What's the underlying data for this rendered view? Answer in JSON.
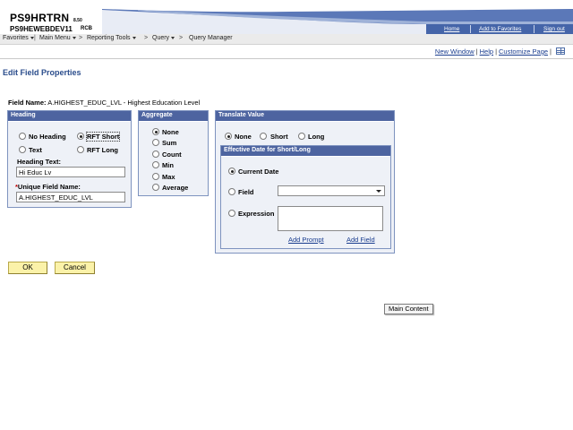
{
  "banner": {
    "app_name": "PS9HRTRN",
    "version": "8.50",
    "database": "PS9HEWEBDEV11",
    "user": "RCB",
    "links": {
      "home": "Home",
      "favorites": "Add to Favorites",
      "signout": "Sign out"
    }
  },
  "menubar": {
    "favorites": "Favorites",
    "main_menu": "Main Menu",
    "reporting_tools": "Reporting Tools",
    "query": "Query",
    "query_manager": "Query Manager",
    "sep": "|",
    "arrow": ">"
  },
  "page_links": {
    "new_window": "New Window",
    "help": "Help",
    "customize": "Customize Page",
    "pipe": "|"
  },
  "page_title": "Edit Field Properties",
  "field_name": {
    "label": "Field Name:",
    "value": "A.HIGHEST_EDUC_LVL - Highest Education Level"
  },
  "heading": {
    "title": "Heading",
    "options": {
      "no_heading": "No Heading",
      "text": "Text",
      "rft_short": "RFT Short",
      "rft_long": "RFT Long"
    },
    "selected": "RFT Short",
    "heading_text_label": "Heading Text:",
    "heading_text_value": "Hi Educ Lv",
    "unique_required": "*",
    "unique_label": "Unique Field Name:",
    "unique_value": "A.HIGHEST_EDUC_LVL"
  },
  "aggregate": {
    "title": "Aggregate",
    "options": [
      "None",
      "Sum",
      "Count",
      "Min",
      "Max",
      "Average"
    ],
    "selected": "None"
  },
  "translate": {
    "title": "Translate Value",
    "options": {
      "none": "None",
      "short": "Short",
      "long": "Long"
    },
    "selected": "None",
    "effdt": {
      "title": "Effective Date for Short/Long",
      "current_date": "Current Date",
      "field": "Field",
      "expression": "Expression",
      "selected": "Current Date",
      "field_value": "",
      "expression_value": "",
      "add_prompt": "Add Prompt",
      "add_field": "Add Field"
    }
  },
  "buttons": {
    "ok": "OK",
    "cancel": "Cancel"
  },
  "tooltip": "Main Content",
  "colors": {
    "brand_blue": "#4565a9",
    "group_header": "#4d64a0",
    "title_blue": "#2b4d8c",
    "button_yellow": "#fbf2a9"
  }
}
